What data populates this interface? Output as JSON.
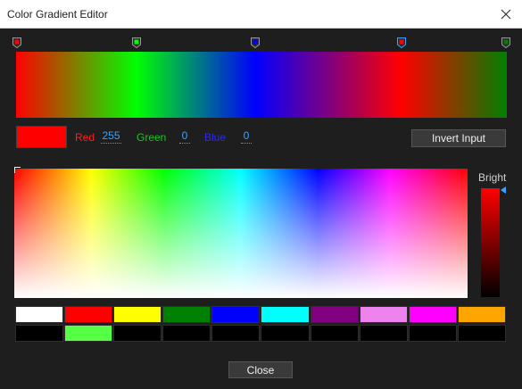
{
  "window": {
    "title": "Color Gradient Editor"
  },
  "gradient": {
    "stops": [
      {
        "color": "#ff0000",
        "position": 0.0,
        "selected": false
      },
      {
        "color": "#00ff00",
        "position": 0.245,
        "selected": false
      },
      {
        "color": "#0000ff",
        "position": 0.488,
        "selected": false
      },
      {
        "color": "#ff0000",
        "position": 0.785,
        "selected": true
      },
      {
        "color": "#008000",
        "position": 1.0,
        "selected": false
      }
    ]
  },
  "color": {
    "current_hex": "#ff0000",
    "red_label": "Red",
    "red_value": "255",
    "green_label": "Green",
    "green_value": "0",
    "blue_label": "Blue",
    "blue_value": "0",
    "invert_button": "Invert Input"
  },
  "picker": {
    "bright_label": "Bright"
  },
  "palette": {
    "row1": [
      "#ffffff",
      "#ff0000",
      "#ffff00",
      "#008000",
      "#0000ff",
      "#00ffff",
      "#800080",
      "#ee82ee",
      "#ff00ff",
      "#ffa500"
    ],
    "row2": [
      "#000000",
      "#55ff44",
      "#000000",
      "#000000",
      "#000000",
      "#000000",
      "#000000",
      "#000000",
      "#000000",
      "#000000"
    ]
  },
  "footer": {
    "close_button": "Close"
  },
  "icons": {
    "close": "close-icon",
    "gradient_stop": "gradient-stop-icon"
  }
}
